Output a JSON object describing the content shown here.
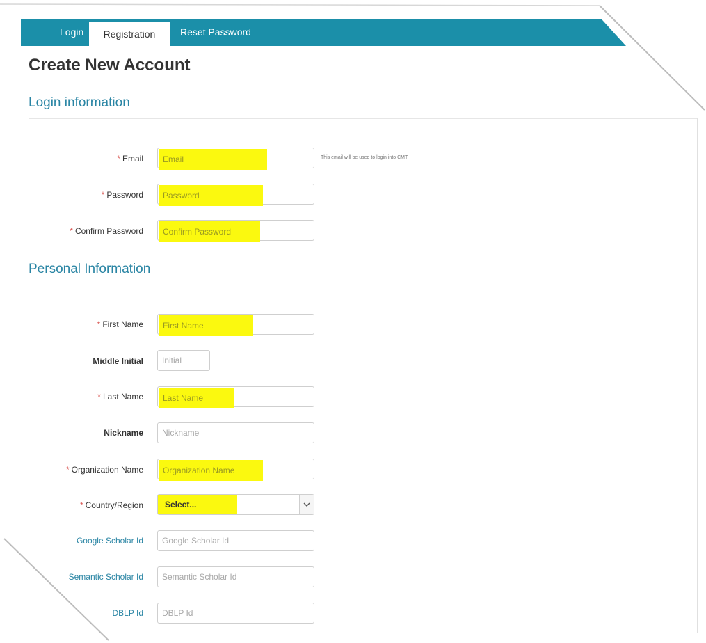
{
  "tabs": {
    "login": "Login",
    "registration": "Registration",
    "reset": "Reset Password"
  },
  "page_title": "Create New Account",
  "login_section": {
    "title": "Login information",
    "email": {
      "label": "Email",
      "placeholder": "Email",
      "help": "This email will be used to login into CMT"
    },
    "password": {
      "label": "Password",
      "placeholder": "Password"
    },
    "confirm_password": {
      "label": "Confirm Password",
      "placeholder": "Confirm Password"
    }
  },
  "personal_section": {
    "title": "Personal Information",
    "first_name": {
      "label": "First Name",
      "placeholder": "First Name"
    },
    "middle_initial": {
      "label": "Middle Initial",
      "placeholder": "Initial"
    },
    "last_name": {
      "label": "Last Name",
      "placeholder": "Last Name"
    },
    "nickname": {
      "label": "Nickname",
      "placeholder": "Nickname"
    },
    "organization": {
      "label": "Organization Name",
      "placeholder": "Organization Name"
    },
    "country": {
      "label": "Country/Region",
      "value": "Select..."
    },
    "google_scholar": {
      "label": "Google Scholar Id",
      "placeholder": "Google Scholar Id"
    },
    "semantic_scholar": {
      "label": "Semantic Scholar Id",
      "placeholder": "Semantic Scholar Id"
    },
    "dblp": {
      "label": "DBLP Id",
      "placeholder": "DBLP Id"
    }
  },
  "required_marker": "*",
  "colors": {
    "tab_bar": "#1b8fa9",
    "section_title": "#2a85a4",
    "highlight": "#fbf90f",
    "required": "#d9534f"
  }
}
